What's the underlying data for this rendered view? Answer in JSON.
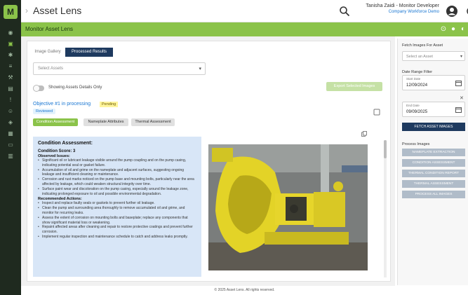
{
  "app": {
    "logo_letter": "M",
    "title": "Asset Lens"
  },
  "user": {
    "name": "Tanisha Zaidi - Monitor Developer",
    "company": "Company Workforce Demo"
  },
  "page": {
    "title": "Monitor Asset Lens"
  },
  "tabs": [
    {
      "label": "Image Gallery"
    },
    {
      "label": "Processed Results"
    }
  ],
  "main": {
    "asset_select_placeholder": "Select Assets",
    "toggle_label": "Showing Assets Details Only",
    "export_button": "Export Selected Images",
    "objective": "Objective #1 in processing",
    "status_pending": "Pending",
    "status_reviewed": "Reviewed",
    "chips": [
      {
        "label": "Condition Assessment"
      },
      {
        "label": "Nameplate Attributes"
      },
      {
        "label": "Thermal Assessment"
      }
    ]
  },
  "assessment": {
    "heading": "Condition Assessment:",
    "title": "Condition Score: 3",
    "observed_heading": "Observed Issues:",
    "observed": [
      "Significant oil or lubricant leakage visible around the pump coupling and on the pump casing, indicating potential seal or gasket failure.",
      "Accumulation of oil and grime on the nameplate and adjacent surfaces, suggesting ongoing leakage and insufficient cleaning or maintenance.",
      "Corrosion and rust marks noticed on the pump base and mounting bolts, particularly near the area affected by leakage, which could weaken structural integrity over time.",
      "Surface paint wear and discoloration on the pump casing, especially around the leakage zone, indicating prolonged exposure to oil and possible environmental degradation."
    ],
    "actions_heading": "Recommended Actions:",
    "actions": [
      "Inspect and replace faulty seals or gaskets to prevent further oil leakage.",
      "Clean the pump and surrounding area thoroughly to remove accumulated oil and grime, and monitor for recurring leaks.",
      "Assess the extent of corrosion on mounting bolts and baseplate; replace any components that show significant material loss or weakening.",
      "Repaint affected areas after cleaning and repair to restore protective coatings and prevent further corrosion.",
      "Implement regular inspection and maintenance schedule to catch and address leaks promptly."
    ]
  },
  "sidebar": {
    "filter_label": "Fetch Images For Asset",
    "asset_placeholder": "Select an Asset",
    "date_label": "Date Range Filter",
    "start_caption": "Start Date",
    "start_date": "12/09/2024",
    "end_caption": "End Date",
    "end_date": "09/09/2025",
    "fetch_button": "FETCH ASSET IMAGES",
    "process_label": "Process Images",
    "process_buttons": [
      {
        "label": "NAMEPLATE EXTRACTION"
      },
      {
        "label": "CONDITION ASSESSMENT"
      },
      {
        "label": "THERMAL CONDITION REPORT"
      },
      {
        "label": "THERMAL ASSESSMENT"
      },
      {
        "label": "PROCESS ALL IMAGES"
      }
    ]
  },
  "footer": {
    "text": "© 2025 Asset Lens. All rights reserved."
  },
  "colors": {
    "accent_green": "#8bc34a",
    "navy": "#1e3a5f",
    "rail": "#1f2a1f",
    "panel_blue": "#d8e6f7",
    "pending_yellow": "#fff59d"
  },
  "icons": [
    "menu-icon",
    "search-icon",
    "account-icon",
    "refresh-icon",
    "help-icon",
    "settings-icon",
    "calendar-icon",
    "close-icon",
    "flag-icon",
    "copy-icon"
  ]
}
